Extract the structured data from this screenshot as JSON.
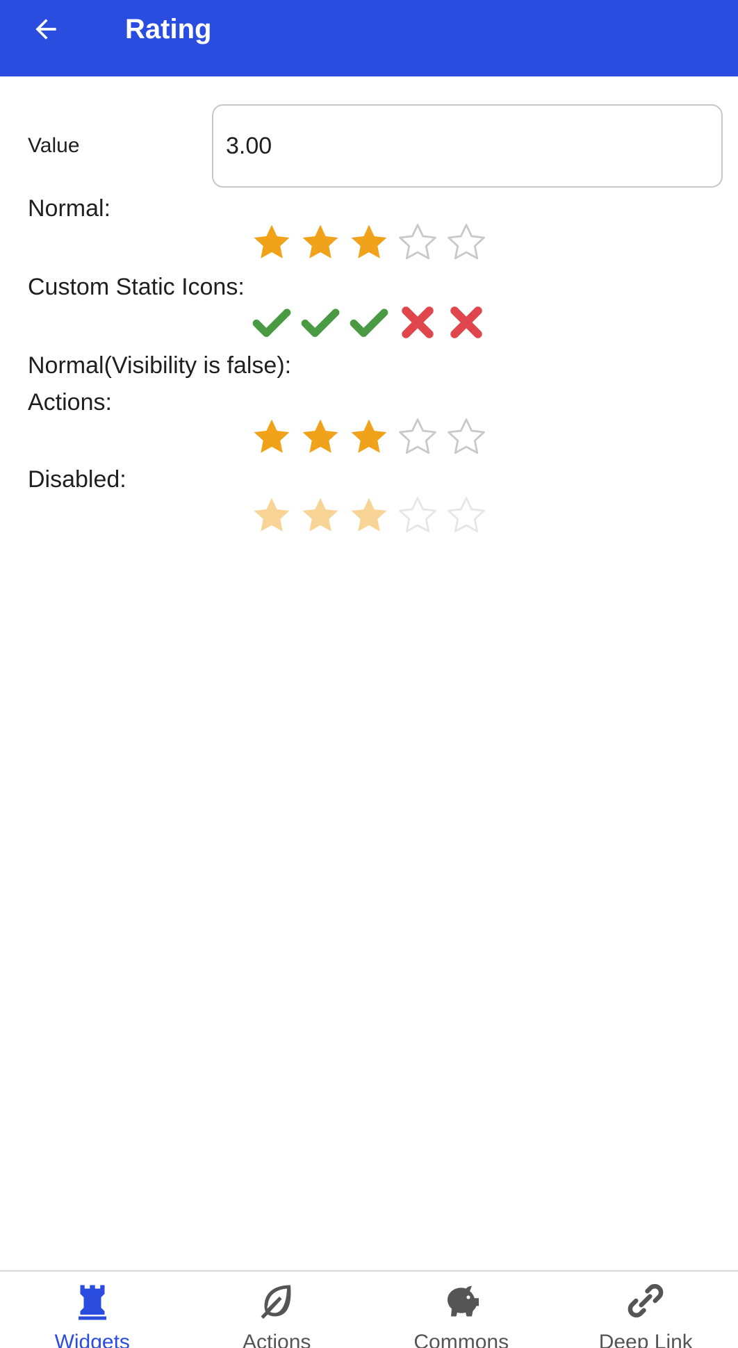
{
  "appbar": {
    "title": "Rating",
    "back_icon": "arrow-left-icon",
    "color": "#2a4de0"
  },
  "form": {
    "value_label": "Value",
    "value": "3.00"
  },
  "sections": {
    "normal": {
      "label": "Normal:",
      "rating": 3,
      "max": 5
    },
    "custom": {
      "label": "Custom Static Icons:",
      "rating": 3,
      "max": 5,
      "on_icon": "check-icon",
      "off_icon": "cross-icon"
    },
    "hidden": {
      "label": "Normal(Visibility is false):"
    },
    "actions": {
      "label": "Actions:",
      "rating": 3,
      "max": 5
    },
    "disabled": {
      "label": "Disabled:",
      "rating": 3,
      "max": 5
    }
  },
  "colors": {
    "star_filled": "#f0a31a",
    "star_empty": "#c9c9c9",
    "check": "#4a9a44",
    "cross": "#e0464c",
    "accent": "#2a4de0"
  },
  "bottom_nav": {
    "items": [
      {
        "label": "Widgets",
        "icon": "rook-icon",
        "active": true
      },
      {
        "label": "Actions",
        "icon": "leaf-icon",
        "active": false
      },
      {
        "label": "Commons",
        "icon": "piggy-bank-icon",
        "active": false
      },
      {
        "label": "Deep Link",
        "icon": "link-icon",
        "active": false
      }
    ]
  }
}
